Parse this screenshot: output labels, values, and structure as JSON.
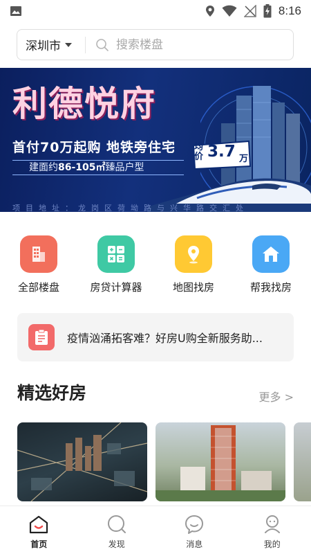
{
  "status_bar": {
    "time": "8:16",
    "icons": [
      "image-icon",
      "location-icon",
      "wifi-icon",
      "no-signal-icon",
      "battery-charging-icon"
    ]
  },
  "search": {
    "city": "深圳市",
    "placeholder": "搜索楼盘"
  },
  "banner": {
    "title": "利德悦府",
    "price_label": "均价",
    "price_value": "3.7",
    "price_unit": "万",
    "slogan": "首付70万起购  地铁旁住宅",
    "area_prefix": "建面约",
    "area_value": "86-105㎡",
    "area_suffix": "臻品户型",
    "footer": "项目地址：龙岗区荷坳路与兴华路交汇处",
    "colors": {
      "background": "#13307c",
      "title": "#ffd2e2",
      "badge": "#ffffff"
    }
  },
  "quick_entries": [
    {
      "label": "全部楼盘",
      "icon": "buildings-icon",
      "color": "#f26f5c"
    },
    {
      "label": "房贷计算器",
      "icon": "calculator-icon",
      "color": "#3fc9a4"
    },
    {
      "label": "地图找房",
      "icon": "map-pin-icon",
      "color": "#ffc933"
    },
    {
      "label": "帮我找房",
      "icon": "home-icon",
      "color": "#4aa8f5"
    }
  ],
  "notice": {
    "icon": "clipboard-icon",
    "text": "疫情汹涌拓客难？好房U购全新服务助..."
  },
  "featured": {
    "title": "精选好房",
    "more": "更多 >"
  },
  "bottom_nav": [
    {
      "label": "首页",
      "icon": "home-smile-icon",
      "active": true
    },
    {
      "label": "发现",
      "icon": "discover-icon",
      "active": false
    },
    {
      "label": "消息",
      "icon": "message-icon",
      "active": false
    },
    {
      "label": "我的",
      "icon": "profile-icon",
      "active": false
    }
  ]
}
